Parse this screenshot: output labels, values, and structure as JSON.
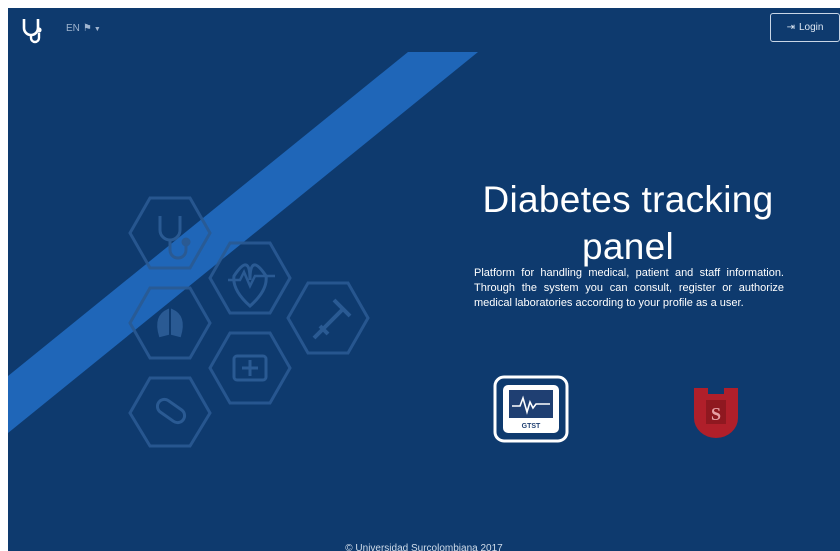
{
  "navbar": {
    "language": "EN",
    "login_label": "Login"
  },
  "hero": {
    "title_line1": "Diabetes tracking",
    "title_line2": "panel",
    "description": "Platform for handling medical, patient and staff information. Through the system you can consult, register or authorize medical laboratories according to your profile as a user."
  },
  "logos": {
    "gtst_label": "GTST",
    "university_letter": "S"
  },
  "footer": {
    "copyright": "© Universidad Surcolombiana 2017"
  },
  "colors": {
    "background": "#0e3a6e",
    "band": "#1f66b8",
    "university_red": "#b01f2a"
  },
  "icons": [
    "stethoscope-icon",
    "flag-icon",
    "login-icon",
    "heartbeat-icon",
    "lungs-icon",
    "syringe-icon",
    "first-aid-kit-icon",
    "pill-icon"
  ]
}
